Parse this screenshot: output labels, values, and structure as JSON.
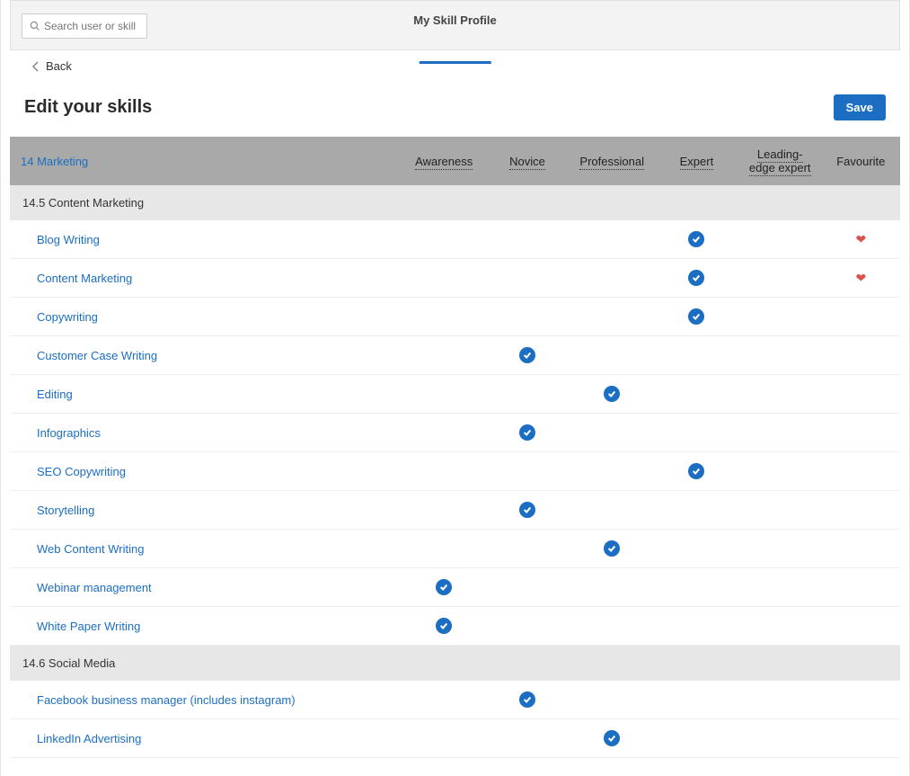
{
  "header": {
    "search_placeholder": "Search user or skill",
    "tab_label": "My Skill Profile",
    "back_label": "Back"
  },
  "title": "Edit your skills",
  "save_label": "Save",
  "columns": {
    "category": "14 Marketing",
    "levels": [
      "Awareness",
      "Novice",
      "Professional",
      "Expert",
      "Leading-edge expert"
    ],
    "favourite": "Favourite"
  },
  "groups": [
    {
      "name": "14.5 Content Marketing",
      "skills": [
        {
          "name": "Blog Writing",
          "level": 3,
          "favourite": true
        },
        {
          "name": "Content Marketing",
          "level": 3,
          "favourite": true
        },
        {
          "name": "Copywriting",
          "level": 3,
          "favourite": false
        },
        {
          "name": "Customer Case Writing",
          "level": 1,
          "favourite": false
        },
        {
          "name": "Editing",
          "level": 2,
          "favourite": false
        },
        {
          "name": "Infographics",
          "level": 1,
          "favourite": false
        },
        {
          "name": "SEO Copywriting",
          "level": 3,
          "favourite": false
        },
        {
          "name": "Storytelling",
          "level": 1,
          "favourite": false
        },
        {
          "name": "Web Content Writing",
          "level": 2,
          "favourite": false
        },
        {
          "name": "Webinar management",
          "level": 0,
          "favourite": false
        },
        {
          "name": "White Paper Writing",
          "level": 0,
          "favourite": false
        }
      ]
    },
    {
      "name": "14.6 Social Media",
      "skills": [
        {
          "name": "Facebook business manager (includes instagram)",
          "level": 1,
          "favourite": false
        },
        {
          "name": "LinkedIn Advertising",
          "level": 2,
          "favourite": false
        }
      ]
    }
  ]
}
